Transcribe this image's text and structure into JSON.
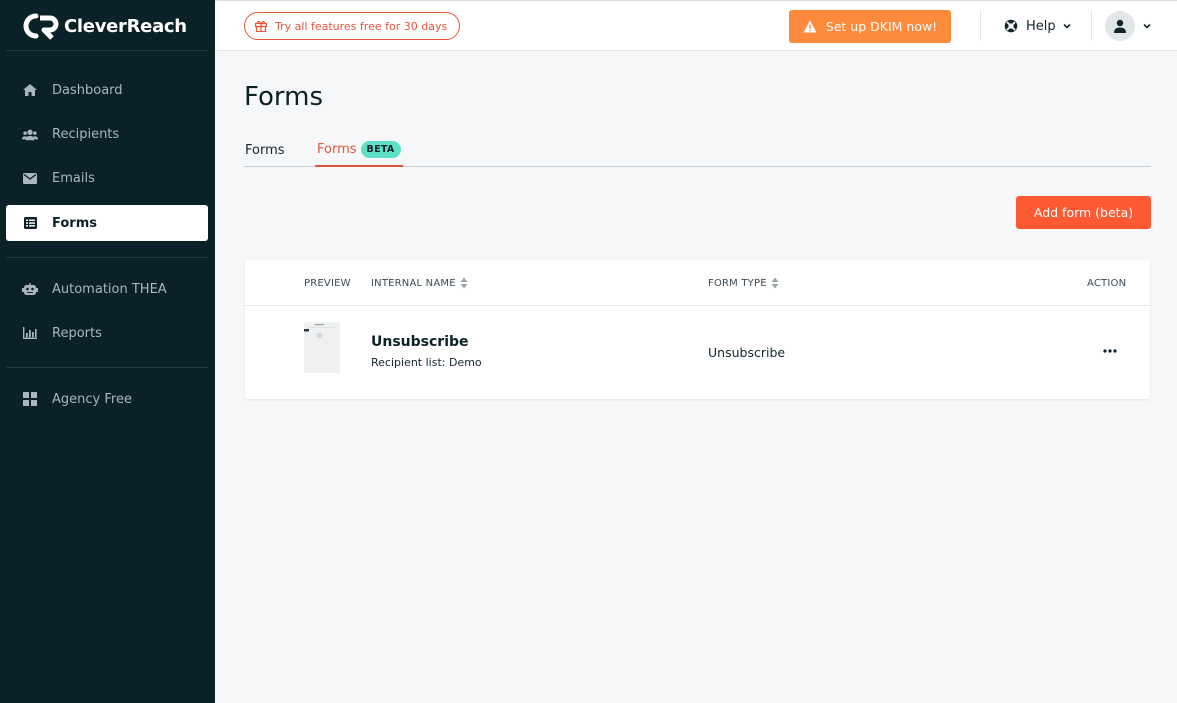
{
  "brand": {
    "name": "CleverReach",
    "accent": "#fd5a33",
    "sidebar_bg": "#0b2128"
  },
  "sidebar": {
    "items": [
      {
        "label": "Dashboard",
        "icon": "home-icon"
      },
      {
        "label": "Recipients",
        "icon": "users-icon"
      },
      {
        "label": "Emails",
        "icon": "envelope-icon"
      },
      {
        "label": "Forms",
        "icon": "list-icon",
        "active": true
      },
      {
        "label": "Automation THEA",
        "icon": "robot-icon"
      },
      {
        "label": "Reports",
        "icon": "bar-chart-icon"
      },
      {
        "label": "Agency Free",
        "icon": "grid-icon"
      }
    ]
  },
  "topbar": {
    "trial_label": "Try all features free for 30 days",
    "dkim_label": "Set up DKIM now!",
    "help_label": "Help"
  },
  "page": {
    "title": "Forms",
    "tabs": [
      {
        "label": "Forms"
      },
      {
        "label": "Forms",
        "badge": "BETA",
        "active": true
      }
    ],
    "add_button": "Add form (beta)"
  },
  "table": {
    "columns": [
      "PREVIEW",
      "INTERNAL NAME",
      "FORM TYPE",
      "ACTION"
    ],
    "rows": [
      {
        "name": "Unsubscribe",
        "sub": "Recipient list: Demo",
        "type": "Unsubscribe"
      }
    ]
  }
}
